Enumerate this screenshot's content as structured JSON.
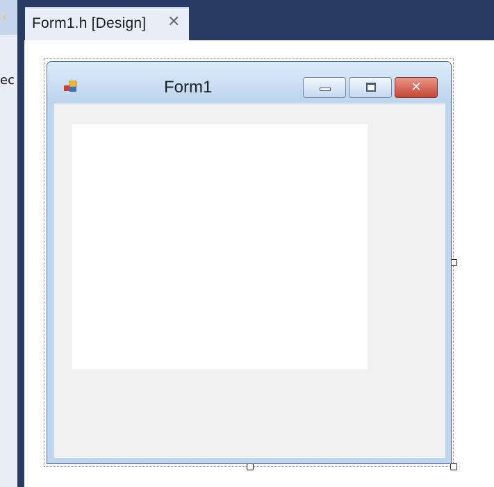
{
  "ide": {
    "tab": {
      "title": "Form1.h [Design]",
      "close_glyph": "✕"
    },
    "left_panel": {
      "arrow_glyph": "‹",
      "clipped_text": "ec"
    }
  },
  "form": {
    "title": "Form1",
    "icon": "form-app-icon",
    "buttons": {
      "minimize": "minimize-icon",
      "maximize": "maximize-icon",
      "close_glyph": "✕"
    }
  },
  "colors": {
    "ide_dark": "#283b63",
    "tab_background": "#e8eef8",
    "form_frame": "#bdd5ee",
    "form_client": "#f0f0f0",
    "close_button": "#c74434"
  }
}
